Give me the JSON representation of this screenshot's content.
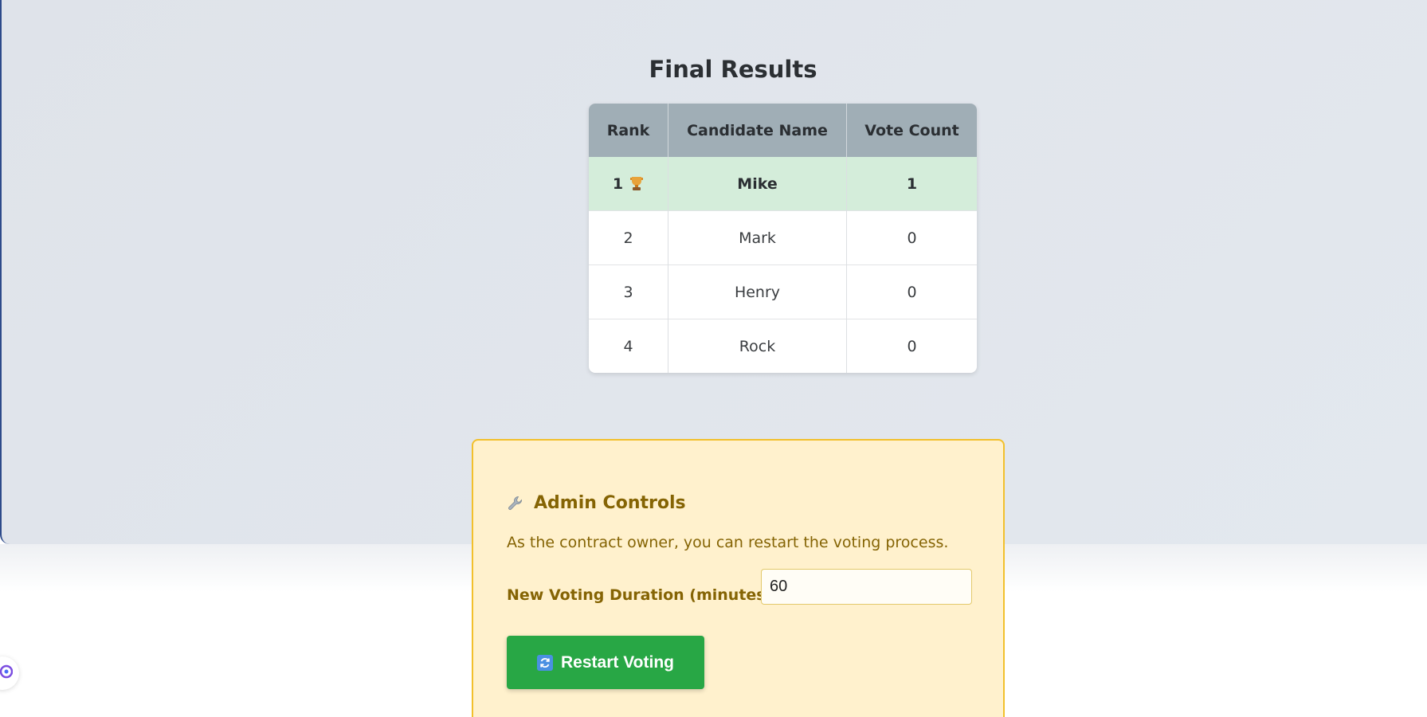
{
  "results": {
    "title": "Final Results",
    "columns": [
      "Rank",
      "Candidate Name",
      "Vote Count"
    ],
    "rows": [
      {
        "rank": "1",
        "name": "Mike",
        "votes": "1",
        "winner": true
      },
      {
        "rank": "2",
        "name": "Mark",
        "votes": "0",
        "winner": false
      },
      {
        "rank": "3",
        "name": "Henry",
        "votes": "0",
        "winner": false
      },
      {
        "rank": "4",
        "name": "Rock",
        "votes": "0",
        "winner": false
      }
    ]
  },
  "admin": {
    "title": "Admin Controls",
    "description": "As the contract owner, you can restart the voting process.",
    "duration_label": "New Voting Duration (minutes):",
    "duration_value": "60",
    "restart_label": "Restart Voting"
  },
  "icons": {
    "winner": "trophy-icon",
    "admin": "wrench-icon",
    "restart": "refresh-icon",
    "floating": "extension-icon"
  },
  "colors": {
    "winner_row": "#d4edda",
    "header": "#a0aeb6",
    "admin_bg": "#fff1cd",
    "admin_border": "#f2c02c",
    "admin_text": "#856404",
    "restart_button": "#28a745"
  }
}
